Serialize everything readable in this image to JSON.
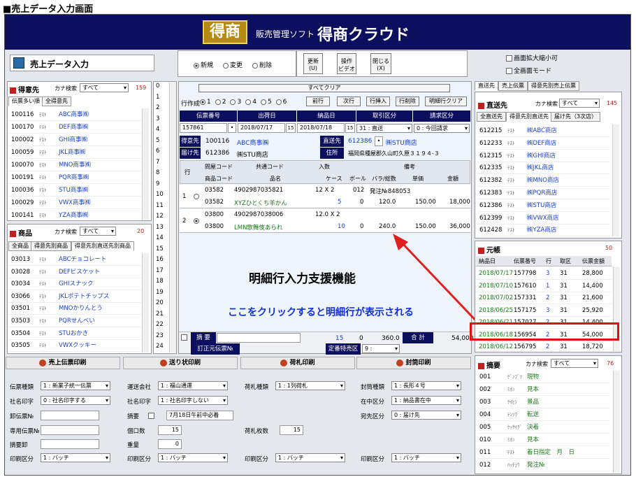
{
  "caption": "■売上データ入力画面",
  "header": {
    "logo": "得商",
    "subtitle": "販売管理ソフト",
    "title": "得商クラウド"
  },
  "left_title": "売上データ入力",
  "mode": {
    "options": [
      "新規",
      "変更",
      "削除"
    ]
  },
  "top_buttons": [
    {
      "l1": "更新",
      "l2": "(U)"
    },
    {
      "l1": "操作",
      "l2": "ビデオ"
    },
    {
      "l1": "閉じる",
      "l2": "(X)"
    }
  ],
  "right_top": {
    "c1": "画面拡大縮小可",
    "c2": "全画面モード"
  },
  "customer": {
    "title": "得意先",
    "search_label": "カナ検索",
    "search_value": "すべて",
    "count": "159",
    "tabs": [
      "伝票多い順",
      "全得意先"
    ],
    "rows": [
      [
        "100116",
        "ﾃｽﾄ",
        "ABC商事㈱"
      ],
      [
        "100170",
        "ﾃｽﾄ",
        "DEF商事㈱"
      ],
      [
        "100002",
        "ﾃｽﾄ",
        "GHI商事㈱"
      ],
      [
        "100059",
        "ﾃｽﾄ",
        "JKL商事㈱"
      ],
      [
        "100070",
        "ﾃｽﾄ",
        "MNO商事㈱"
      ],
      [
        "100191",
        "ﾃｽﾄ",
        "PQR商事㈱"
      ],
      [
        "100036",
        "ﾃｽﾄ",
        "STU商事㈱"
      ],
      [
        "100029",
        "ﾃｽﾄ",
        "VWX商事㈱"
      ],
      [
        "100141",
        "ﾃｽﾄ",
        "YZA商事㈱"
      ]
    ]
  },
  "product": {
    "title": "商品",
    "search_label": "カナ検索",
    "search_value": "すべて",
    "count": "20",
    "tabs": [
      "全商品",
      "得意先別商品",
      "得意先別直送先別商品"
    ],
    "rows": [
      [
        "03013",
        "ﾃｽﾄ",
        "ABCチョコレート"
      ],
      [
        "03028",
        "ﾃｽﾄ",
        "DEFビスケット"
      ],
      [
        "03034",
        "ﾃｽﾄ",
        "GHIスナック"
      ],
      [
        "03066",
        "ﾃｽﾄ",
        "JKLポテトチップス"
      ],
      [
        "03501",
        "ﾃｽﾄ",
        "MNOかりんとう"
      ],
      [
        "03503",
        "ﾃｽﾄ",
        "PQRせんべい"
      ],
      [
        "03504",
        "ﾃｽﾄ",
        "STUおかき"
      ],
      [
        "03505",
        "ﾃｽﾄ",
        "VWXクッキー"
      ]
    ]
  },
  "rownums": [
    "0",
    "1",
    "2",
    "3",
    "4",
    "5",
    "6",
    "7",
    "8",
    "9",
    "10",
    "11",
    "12",
    "13",
    "14",
    "15",
    "16",
    "17",
    "18",
    "19",
    "20",
    "21",
    "22",
    "23",
    "24"
  ],
  "center": {
    "all_clear": "すべてクリア",
    "row_make": "行作成",
    "radios": [
      "1",
      "2",
      "3",
      "4",
      "5",
      "6"
    ],
    "buttons": [
      "前行",
      "次行",
      "行挿入",
      "行削除",
      "明細行クリア"
    ],
    "hd": [
      "伝票番号",
      "出荷日",
      "納品日",
      "取引区分",
      "請求区分"
    ],
    "vals": {
      "slip": "157861",
      "ship": "2018/07/17",
      "deliv": "2018/07/18",
      "trade": "31 : 直送",
      "bill": "0 : 今回請求"
    },
    "cust_lbl": "得意先",
    "cust_code": "100116",
    "cust_name": "ABC商事㈱",
    "direct_lbl": "直送先",
    "direct_code": "612386",
    "direct_name": "㈱STU商店",
    "dest_lbl": "届け先",
    "dest_code": "612386",
    "dest_name": "㈱STU商店",
    "addr_lbl": "住所",
    "addr": "福岡県種屋郡久山町久原３１９４-３",
    "col_hd": {
      "row": "行",
      "c1a": "問屋コード",
      "c1b": "商品コード",
      "c2a": "共通コード",
      "c2b": "品名",
      "c3a": "入数",
      "c3b": "ケース",
      "c4": "ボール",
      "c5": "バラ/総数",
      "c6a": "備考",
      "c6b": "単価",
      "c7": "金額"
    },
    "lines": [
      {
        "no": "1",
        "wcode": "03582",
        "jan": "4902987035821",
        "iri": "12 X 2",
        "ball": "012",
        "note": "発注№848053",
        "pcode": "03582",
        "name": "XYZひとくち羊かん",
        "case": "5",
        "b2": "0",
        "qty": "120.0",
        "price": "150.00",
        "amount": "18,000"
      },
      {
        "no": "2",
        "wcode": "03800",
        "jan": "4902987038006",
        "iri": "12.0 X 2",
        "ball": "",
        "note": "",
        "pcode": "03800",
        "name": "LMN歌舞伎あられ",
        "case": "10",
        "b2": "0",
        "qty": "240.0",
        "price": "150.00",
        "amount": "36,000"
      }
    ],
    "annot1": "明細行入力支援機能",
    "annot2": "ここをクリックすると明細行が表示される",
    "foot": {
      "tekiyo": "摘 要",
      "case": "15",
      "ball": "0",
      "qty": "360.0",
      "total_lbl": "合 計",
      "total": "54,000",
      "fix_lbl": "訂正元伝票№",
      "tokuban_lbl": "定番特売区分",
      "tokuban": "9 :"
    }
  },
  "bottom": {
    "s1": {
      "title": "売上伝票印刷",
      "rows": [
        [
          "伝票種類",
          "1 : 新業子統一伝票"
        ],
        [
          "社名印字",
          "0 : 社名印字する"
        ],
        [
          "卸伝票№",
          ""
        ],
        [
          "専用伝票№",
          ""
        ],
        [
          "摘要卸",
          ""
        ],
        [
          "印刷区分",
          "1 : バッチ"
        ]
      ]
    },
    "s2": {
      "title": "送り状印刷",
      "rows": [
        [
          "運送会社",
          "1 : 福山通運"
        ],
        [
          "社名印字",
          "1 : 社名印字しない"
        ],
        [
          "摘要",
          "7月18日午前中必着"
        ],
        [
          "個口数",
          "15"
        ],
        [
          "重量",
          "0"
        ],
        [
          "印刷区分",
          "1 : バッチ"
        ]
      ]
    },
    "s3": {
      "title": "荷札印刷",
      "rows": [
        [
          "荷札種類",
          "1 : 1列荷札"
        ],
        [
          "荷札枚数",
          "15"
        ],
        [
          "印刷区分",
          "1 : バッチ"
        ]
      ]
    },
    "s4": {
      "title": "封筒印刷",
      "rows": [
        [
          "封筒種類",
          "1 : 長形４号"
        ],
        [
          "在中区分",
          "1 : 納品書在中"
        ],
        [
          "宛先区分",
          "0 : 届け先"
        ],
        [
          "印刷区分",
          "1 : バッチ"
        ]
      ]
    }
  },
  "right": {
    "tabs": [
      "直送先",
      "売上伝票",
      "得意先別売上伝票"
    ],
    "direct_title": "直送先",
    "search_label": "カナ検索",
    "search_value": "すべて",
    "count": "145",
    "subtabs": [
      "全直送先",
      "得意先別直送先",
      "届け先（3次店）"
    ],
    "rows": [
      [
        "612215",
        "ﾃｽﾄ",
        "㈱ABC商店"
      ],
      [
        "612233",
        "ﾃｽﾄ",
        "㈱DEF商店"
      ],
      [
        "612315",
        "ﾃｽﾄ",
        "㈱GHI商店"
      ],
      [
        "612335",
        "ﾃｽﾄ",
        "㈱JKL商店"
      ],
      [
        "612382",
        "ﾃｽﾄ",
        "㈱MNO商店"
      ],
      [
        "612383",
        "ﾃｽﾄ",
        "㈱PQR商店"
      ],
      [
        "612386",
        "ﾃｽﾄ",
        "㈱STU商店"
      ],
      [
        "612399",
        "ﾃｽﾄ",
        "㈱VWX商店"
      ],
      [
        "612428",
        "ﾃｽﾄ",
        "㈱YZA商店"
      ]
    ],
    "ledger_title": "元帳",
    "ledger_count": "50",
    "ledger_hd": [
      "納品日",
      "伝票番号",
      "行",
      "取区",
      "伝票金額"
    ],
    "ledger": [
      [
        "2018/07/17",
        "157798",
        "3",
        "31",
        "28,800"
      ],
      [
        "2018/07/10",
        "157610",
        "1",
        "31",
        "14,400"
      ],
      [
        "2018/07/02",
        "157331",
        "2",
        "31",
        "21,600"
      ],
      [
        "2018/06/25",
        "157175",
        "3",
        "31",
        "25,920"
      ],
      [
        "2018/06/21",
        "157027",
        "2",
        "31",
        "14,400"
      ],
      [
        "2018/06/18",
        "156954",
        "2",
        "31",
        "54,000"
      ],
      [
        "2018/06/12",
        "156795",
        "2",
        "31",
        "18,720"
      ]
    ],
    "memo_title": "摘要",
    "memo_search": "カナ検索",
    "memo_value": "すべて",
    "memo_count": "76",
    "memo": [
      [
        "001",
        "ｹﾞﾝﾌﾞﾂ",
        "現物"
      ],
      [
        "002",
        "ﾐﾎﾝ",
        "見本"
      ],
      [
        "003",
        "ｹｲﾋﾝ",
        "景品"
      ],
      [
        "004",
        "ﾃﾝｿｳ",
        "転送"
      ],
      [
        "005",
        "ｹｯｻｲｸﾞ",
        "決着"
      ],
      [
        "010",
        "ﾐﾎﾝ",
        "見本"
      ],
      [
        "011",
        "ﾃｽﾄ",
        "着日指定　月　日"
      ],
      [
        "012",
        "ﾊｯﾁｭｳ",
        "発注№"
      ]
    ]
  }
}
